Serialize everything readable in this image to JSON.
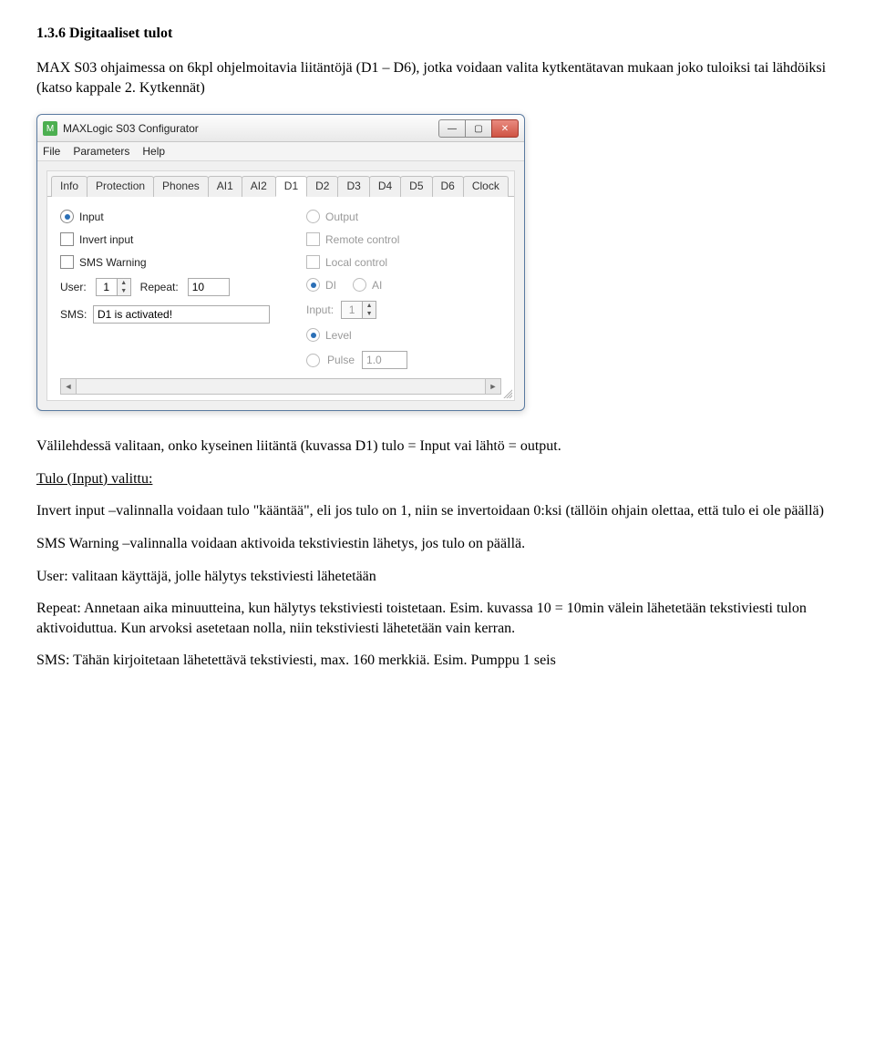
{
  "doc": {
    "heading": "1.3.6  Digitaaliset tulot",
    "intro": "MAX S03 ohjaimessa on 6kpl ohjelmoitavia liitäntöjä (D1 – D6), jotka voidaan valita kytkentätavan mukaan joko tuloiksi tai lähdöiksi (katso kappale 2. Kytkennät)",
    "after_img": "Välilehdessä valitaan, onko kyseinen liitäntä (kuvassa D1) tulo = Input vai lähtö = output.",
    "subhead": "Tulo (Input) valittu:",
    "p1": "Invert input –valinnalla voidaan tulo \"kääntää\", eli jos tulo on 1, niin se invertoidaan 0:ksi (tällöin ohjain olettaa, että tulo ei ole päällä)",
    "p2": "SMS Warning –valinnalla voidaan aktivoida tekstiviestin lähetys, jos tulo on päällä.",
    "p3": "User: valitaan käyttäjä, jolle hälytys tekstiviesti lähetetään",
    "p4": "Repeat: Annetaan aika minuutteina, kun hälytys tekstiviesti toistetaan. Esim. kuvassa 10 = 10min välein lähetetään tekstiviesti tulon aktivoiduttua. Kun arvoksi asetetaan nolla, niin tekstiviesti lähetetään vain kerran.",
    "p5": "SMS: Tähän kirjoitetaan lähetettävä tekstiviesti, max. 160 merkkiä. Esim. Pumppu 1 seis"
  },
  "window": {
    "app_icon_text": "M",
    "title": "MAXLogic S03 Configurator",
    "menu": {
      "file": "File",
      "parameters": "Parameters",
      "help": "Help"
    },
    "tabs": [
      "Info",
      "Protection",
      "Phones",
      "AI1",
      "AI2",
      "D1",
      "D2",
      "D3",
      "D4",
      "D5",
      "D6",
      "Clock"
    ],
    "active_tab": "D1"
  },
  "d1": {
    "input_label": "Input",
    "output_label": "Output",
    "invert_label": "Invert input",
    "remote_label": "Remote control",
    "sms_warning_label": "SMS Warning",
    "local_label": "Local control",
    "di_label": "DI",
    "ai_label": "AI",
    "user_label": "User:",
    "user_value": "1",
    "repeat_label": "Repeat:",
    "repeat_value": "10",
    "input_right_label": "Input:",
    "input_right_value": "1",
    "sms_label": "SMS:",
    "sms_value": "D1 is activated!",
    "level_label": "Level",
    "pulse_label": "Pulse",
    "pulse_value": "1.0"
  }
}
